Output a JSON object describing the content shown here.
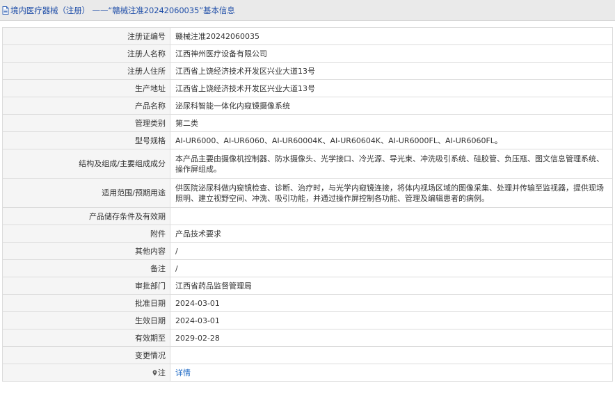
{
  "header": {
    "title": "境内医疗器械（注册） ——“赣械注准20242060035”基本信息"
  },
  "rows": [
    {
      "label": "注册证编号",
      "value": "赣械注准20242060035"
    },
    {
      "label": "注册人名称",
      "value": "江西神州医疗设备有限公司"
    },
    {
      "label": "注册人住所",
      "value": "江西省上饶经济技术开发区兴业大道13号"
    },
    {
      "label": "生产地址",
      "value": "江西省上饶经济技术开发区兴业大道13号"
    },
    {
      "label": "产品名称",
      "value": "泌尿科智能一体化内窥镜摄像系统"
    },
    {
      "label": "管理类别",
      "value": "第二类"
    },
    {
      "label": "型号规格",
      "value": "AI-UR6000、AI-UR6060、AI-UR60004K、AI-UR60604K、AI-UR6000FL、AI-UR6060FL。"
    },
    {
      "label": "结构及组成/主要组成成分",
      "value": "本产品主要由摄像机控制器、防水摄像头、光学接口、冷光源、导光束、冲洗吸引系统、硅胶管、负压瓶、图文信息管理系统、操作屏组成。"
    },
    {
      "label": "适用范围/预期用途",
      "value": "供医院泌尿科做内窥镜检查、诊断、治疗时，与光学内窥镜连接，将体内视场区域的图像采集、处理并传输至监视器，提供现场照明、建立视野空间、冲洗、吸引功能，并通过操作屏控制各功能、管理及编辑患者的病例。"
    },
    {
      "label": "产品储存条件及有效期",
      "value": ""
    },
    {
      "label": "附件",
      "value": "产品技术要求"
    },
    {
      "label": "其他内容",
      "value": "/"
    },
    {
      "label": "备注",
      "value": "/"
    },
    {
      "label": "审批部门",
      "value": "江西省药品监督管理局"
    },
    {
      "label": "批准日期",
      "value": "2024-03-01"
    },
    {
      "label": "生效日期",
      "value": "2024-03-01"
    },
    {
      "label": "有效期至",
      "value": "2029-02-28"
    },
    {
      "label": "变更情况",
      "value": ""
    }
  ],
  "note": {
    "label": "注",
    "link_text": "详情"
  },
  "icons": {
    "header_icon": "document-icon",
    "note_icon": "pin-icon"
  },
  "colors": {
    "title": "#1f4ea8",
    "link": "#1a67c4",
    "label_bg": "#f5f5f5",
    "header_bg": "#eaeaea"
  }
}
